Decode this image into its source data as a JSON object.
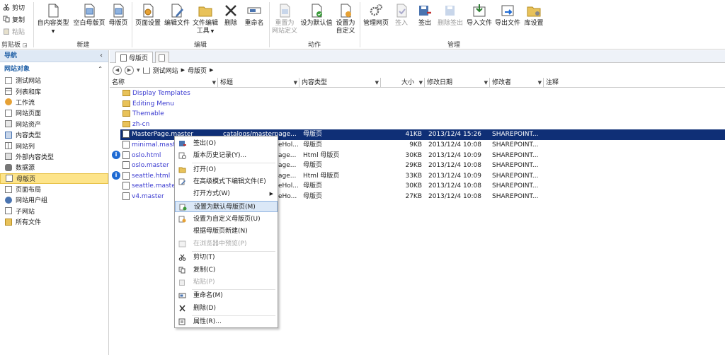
{
  "ribbon": {
    "clipboard": {
      "cut": "剪切",
      "copy": "复制",
      "paste": "粘贴",
      "group": "剪贴板"
    },
    "new": {
      "from_content_type": "自内容类型",
      "blank_master": "空白母版页",
      "master": "母版页",
      "group": "新建"
    },
    "edit": {
      "page_layout": "页面设置",
      "edit_file": "编辑文件",
      "edit_file_tools": "文件编辑",
      "tools": "工具",
      "delete": "删除",
      "rename": "重命名",
      "group": "编辑"
    },
    "actions": {
      "reset_line1": "重置为",
      "reset_line2": "网站定义",
      "set_default": "设为默认值",
      "set_custom_line1": "设置为",
      "set_custom_line2": "自定义",
      "group": "动作"
    },
    "manage": {
      "admin": "管理网页",
      "checkin": "签入",
      "checkout": "签出",
      "discard": "删除签出",
      "import": "导入文件",
      "export": "导出文件",
      "library": "库设置",
      "group": "管理"
    }
  },
  "nav": {
    "title": "导航",
    "section": "网站对象",
    "items": [
      "测试网站",
      "列表和库",
      "工作流",
      "网站页面",
      "网站资产",
      "内容类型",
      "网站列",
      "外部内容类型",
      "数据源",
      "母版页",
      "页面布局",
      "网站用户组",
      "子网站",
      "所有文件"
    ]
  },
  "tabs": {
    "active": "母版页"
  },
  "breadcrumb": {
    "site": "测试网站",
    "page": "母版页"
  },
  "columns": {
    "name": "名称",
    "title": "标题",
    "content_type": "内容类型",
    "size": "大小",
    "modified": "修改日期",
    "modified_by": "修改者",
    "comments": "注释"
  },
  "folders": [
    "Display Templates",
    "Editing Menu",
    "Themable",
    "zh-cn"
  ],
  "files": [
    {
      "name": "MasterPage.master",
      "title": "catalogs/masterpage...",
      "type": "母版页",
      "size": "41KB",
      "date": "2013/12/4 15:26",
      "by": "SHAREPOINT..."
    },
    {
      "name": "minimal.mast",
      "title": "eHol...",
      "type": "母版页",
      "size": "9KB",
      "date": "2013/12/4 10:08",
      "by": "SHAREPOINT..."
    },
    {
      "name": "oslo.html",
      "title": "age...",
      "type": "Html 母版页",
      "size": "30KB",
      "date": "2013/12/4 10:09",
      "by": "SHAREPOINT..."
    },
    {
      "name": "oslo.master",
      "title": "age...",
      "type": "母版页",
      "size": "29KB",
      "date": "2013/12/4 10:08",
      "by": "SHAREPOINT..."
    },
    {
      "name": "seattle.html",
      "title": "age...",
      "type": "Html 母版页",
      "size": "33KB",
      "date": "2013/12/4 10:09",
      "by": "SHAREPOINT..."
    },
    {
      "name": "seattle.maste",
      "title": "eHol...",
      "type": "母版页",
      "size": "30KB",
      "date": "2013/12/4 10:08",
      "by": "SHAREPOINT..."
    },
    {
      "name": "v4.master",
      "title": "eHo...",
      "type": "母版页",
      "size": "27KB",
      "date": "2013/12/4 10:08",
      "by": "SHAREPOINT..."
    }
  ],
  "context_menu": {
    "checkout": "签出(O)",
    "history": "版本历史记录(Y)...",
    "open": "打开(O)",
    "open_advanced": "在高级模式下编辑文件(E)",
    "open_with": "打开方式(W)",
    "set_default": "设置为默认母版页(M)",
    "set_custom": "设置为自定义母版页(U)",
    "new_from": "根据母版页新建(N)",
    "preview": "在浏览器中预览(P)",
    "cut": "剪切(T)",
    "copy": "复制(C)",
    "paste": "粘贴(P)",
    "rename": "重命名(M)",
    "delete": "删除(D)",
    "properties": "属性(R)..."
  }
}
